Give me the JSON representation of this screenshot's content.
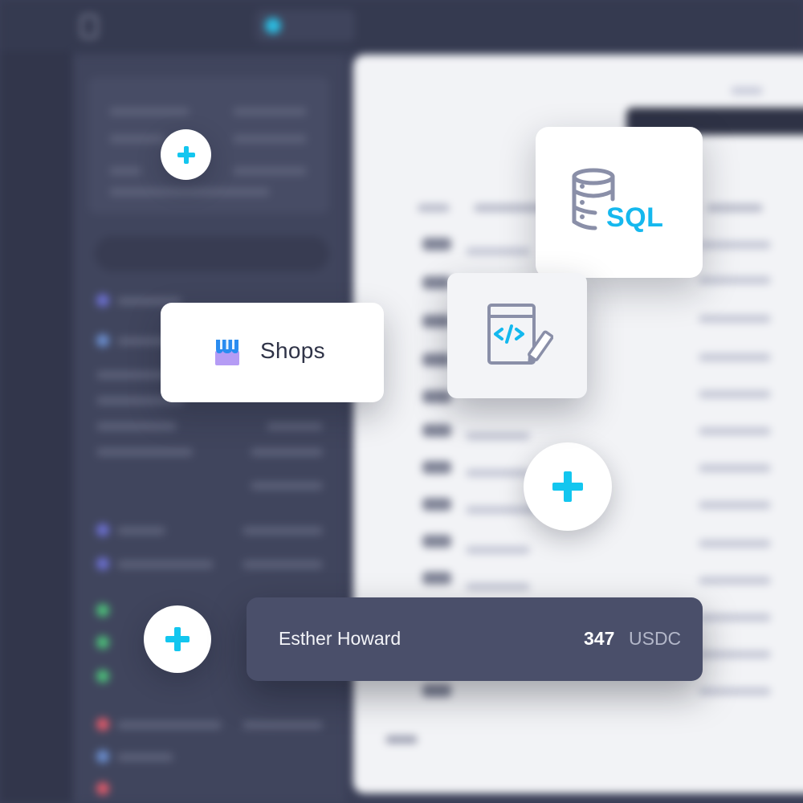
{
  "shops_card": {
    "label": "Shops",
    "icon": "shop-icon"
  },
  "sql_card": {
    "label": "SQL",
    "icon": "database-sql-icon"
  },
  "code_card": {
    "icon": "code-edit-icon"
  },
  "user_card": {
    "name": "Esther Howard",
    "amount": "347",
    "currency": "USDC"
  },
  "add_buttons": [
    {
      "icon": "plus-icon"
    },
    {
      "icon": "plus-icon"
    },
    {
      "icon": "plus-icon"
    }
  ],
  "colors": {
    "accent": "#13c6ef",
    "background": "#3a3f57",
    "user_card": "#4a4f6a",
    "card": "#ffffff"
  }
}
